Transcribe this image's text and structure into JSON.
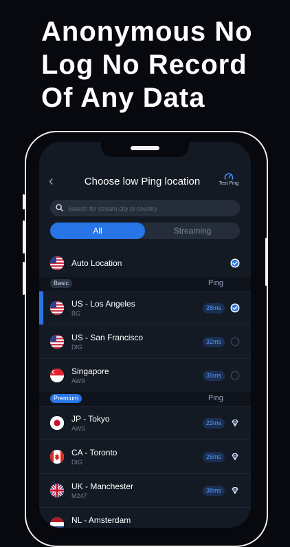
{
  "headline": "Anonymous No\nLog No Record\nOf Any Data",
  "header": {
    "title": "Choose low Ping location",
    "test_ping_label": "Test Ping"
  },
  "search": {
    "placeholder": "Search for stream,city or country",
    "value": ""
  },
  "tabs": [
    {
      "label": "All",
      "active": true
    },
    {
      "label": "Streaming",
      "active": false
    }
  ],
  "auto_location": {
    "name": "Auto Location",
    "selected": true
  },
  "groups": [
    {
      "label": "Basic",
      "ping_header": "Ping",
      "items": [
        {
          "name": "US - Los Angeles",
          "provider": "BG",
          "ping": "28ms",
          "flag": "us-flag-icon",
          "selected": true
        },
        {
          "name": "US - San Francisco",
          "provider": "DIG",
          "ping": "32ms",
          "flag": "us-flag-icon",
          "selected": false
        },
        {
          "name": "Singapore",
          "provider": "AWS",
          "ping": "35ms",
          "flag": "sg-flag-icon",
          "selected": false
        }
      ]
    },
    {
      "label": "Premium",
      "ping_header": "Ping",
      "items": [
        {
          "name": "JP - Tokyo",
          "provider": "AWS",
          "ping": "22ms",
          "flag": "jp-flag-icon",
          "badge": "diamond-icon"
        },
        {
          "name": "CA - Toronto",
          "provider": "DIG",
          "ping": "26ms",
          "flag": "ca-flag-icon",
          "badge": "diamond-icon"
        },
        {
          "name": "UK - Manchester",
          "provider": "M247",
          "ping": "38ms",
          "flag": "uk-flag-icon",
          "badge": "diamond-icon"
        },
        {
          "name": "NL - Amsterdam",
          "provider": "",
          "ping": "",
          "flag": "nl-flag-icon",
          "badge": "diamond-icon"
        }
      ]
    }
  ],
  "colors": {
    "accent": "#2775e6",
    "background": "#07090f",
    "screen": "#141a24",
    "ping_text": "#5a9bff"
  }
}
